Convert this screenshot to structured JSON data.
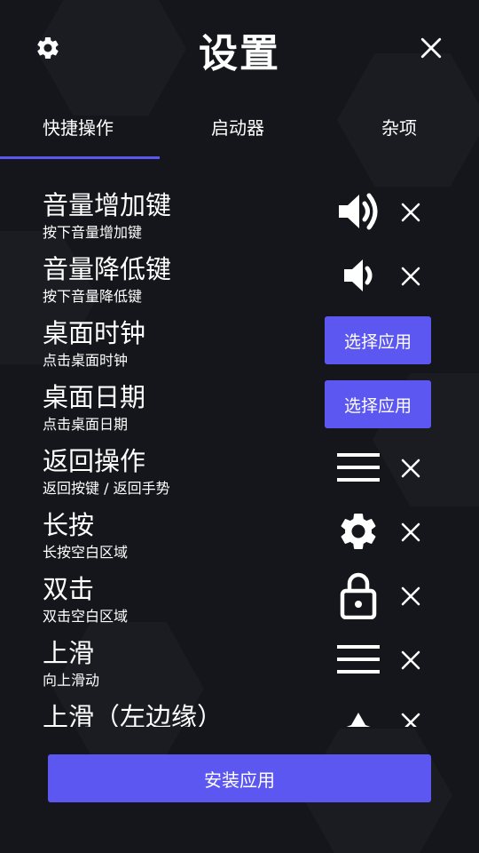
{
  "header": {
    "title": "设置",
    "settings_icon": "gear-icon",
    "close_icon": "close-icon"
  },
  "tabs": [
    {
      "label": "快捷操作",
      "active": true
    },
    {
      "label": "启动器",
      "active": false
    },
    {
      "label": "杂项",
      "active": false
    }
  ],
  "rows": [
    {
      "title": "音量增加键",
      "subtitle": "按下音量增加键",
      "action_icon": "volume-up-icon",
      "removable": true
    },
    {
      "title": "音量降低键",
      "subtitle": "按下音量降低键",
      "action_icon": "volume-down-icon",
      "removable": true
    },
    {
      "title": "桌面时钟",
      "subtitle": "点击桌面时钟",
      "button_label": "选择应用"
    },
    {
      "title": "桌面日期",
      "subtitle": "点击桌面日期",
      "button_label": "选择应用"
    },
    {
      "title": "返回操作",
      "subtitle": "返回按键 / 返回手势",
      "action_icon": "menu-icon",
      "removable": true
    },
    {
      "title": "长按",
      "subtitle": "长按空白区域",
      "action_icon": "gear-icon",
      "removable": true
    },
    {
      "title": "双击",
      "subtitle": "双击空白区域",
      "action_icon": "lock-icon",
      "removable": true
    },
    {
      "title": "上滑",
      "subtitle": "向上滑动",
      "action_icon": "menu-icon",
      "removable": true
    },
    {
      "title": "上滑（左边缘）",
      "subtitle": "",
      "action_icon": "triangle-up-icon",
      "removable": true
    }
  ],
  "footer": {
    "install_label": "安装应用"
  },
  "colors": {
    "accent": "#5b57f0",
    "background": "#15161b",
    "text": "#ffffff"
  }
}
